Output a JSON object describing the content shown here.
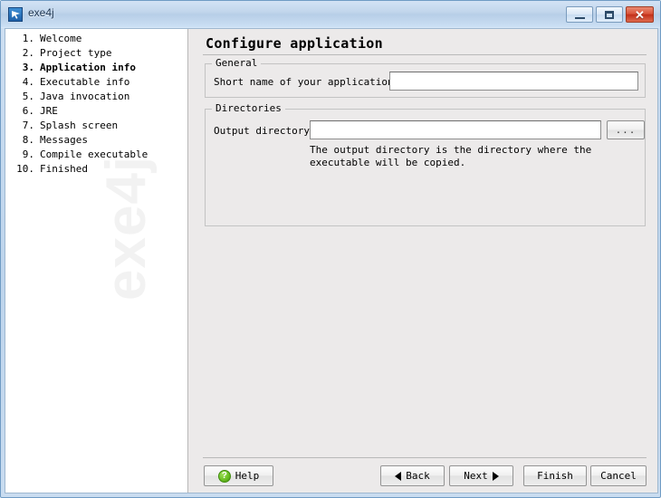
{
  "window": {
    "title": "exe4j",
    "icon": "app-icon",
    "controls": {
      "minimize": "minimize-icon",
      "maximize": "maximize-icon",
      "close": "✕"
    }
  },
  "sidebar": {
    "watermark": "exe4j",
    "steps": [
      {
        "num": "1.",
        "label": "Welcome",
        "current": false
      },
      {
        "num": "2.",
        "label": "Project type",
        "current": false
      },
      {
        "num": "3.",
        "label": "Application info",
        "current": true
      },
      {
        "num": "4.",
        "label": "Executable info",
        "current": false
      },
      {
        "num": "5.",
        "label": "Java invocation",
        "current": false
      },
      {
        "num": "6.",
        "label": "JRE",
        "current": false
      },
      {
        "num": "7.",
        "label": "Splash screen",
        "current": false
      },
      {
        "num": "8.",
        "label": "Messages",
        "current": false
      },
      {
        "num": "9.",
        "label": "Compile executable",
        "current": false
      },
      {
        "num": "10.",
        "label": "Finished",
        "current": false
      }
    ]
  },
  "content": {
    "page_title": "Configure application",
    "general": {
      "legend": "General",
      "short_name_label": "Short name of your application:",
      "short_name_value": "",
      "short_name_placeholder": ""
    },
    "directories": {
      "legend": "Directories",
      "output_dir_label": "Output directory:",
      "output_dir_value": "",
      "output_dir_placeholder": "",
      "browse_label": "...",
      "hint": "The output directory is the directory where the executable will be copied."
    }
  },
  "buttons": {
    "help": "Help",
    "back": "Back",
    "next": "Next",
    "finish": "Finish",
    "cancel": "Cancel",
    "help_icon_glyph": "?"
  },
  "colors": {
    "title_bar": "#c2d6ec",
    "close_button": "#c2301a",
    "panel_background": "#eceaea",
    "sidebar_background": "#ffffff",
    "help_icon": "#6cc024",
    "watermark": "#f2f2f2"
  }
}
